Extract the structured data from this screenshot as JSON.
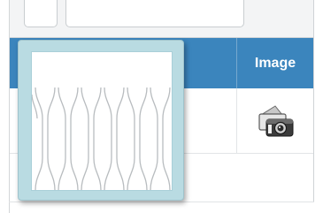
{
  "table": {
    "header": {
      "image_column_label": "Image"
    },
    "rows": [
      {
        "image_icon": "camera-icon"
      }
    ]
  },
  "popup": {
    "preview_icon": "ribbon-cable-outline-icon"
  },
  "colors": {
    "header_blue": "#3b85bd",
    "popup_border": "#b9dbe2"
  }
}
